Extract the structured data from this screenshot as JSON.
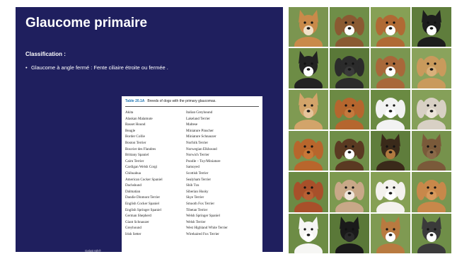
{
  "slide": {
    "title": "Glaucome primaire",
    "classification_label": "Classification :",
    "bullet": "Glaucome à angle fermé : Fente ciliaire étroite ou fermée .",
    "footer": "Gelatt 6th®"
  },
  "table": {
    "number": "Table 20.1A",
    "caption": "Breeds of dogs with the primary glaucomas.",
    "left_column": [
      "Akita",
      "Alaskan Malamute",
      "Basset Hound",
      "Beagle",
      "Border Collie",
      "Boston Terrier",
      "Bouvier des Flandres",
      "Brittany Spaniel",
      "Cairn Terrier",
      "Cardigan Welsh Corgi",
      "Chihuahua",
      "American Cocker Spaniel",
      "Dachshund",
      "Dalmatian",
      "Dandie Dinmont Terrier",
      "English Cocker Spaniel",
      "English Springer Spaniel",
      "German Shepherd",
      "Giant Schnauzer",
      "Greyhound",
      "Irish Setter"
    ],
    "right_column": [
      "Italian Greyhound",
      "Lakeland Terrier",
      "Maltese",
      "Miniature Pinscher",
      "Miniature Schnauzer",
      "Norfolk Terrier",
      "Norwegian Elkhound",
      "Norwich Terrier",
      "Poodle – Toy/Miniature",
      "Samoyed",
      "Scottish Terrier",
      "Sealyham Terrier",
      "Shih Tzu",
      "Siberian Husky",
      "Skye Terrier",
      "Smooth Fox Terrier",
      "Tibetan Terrier",
      "Welsh Springer Spaniel",
      "Welsh Terrier",
      "West Highland White Terrier",
      "Wirehaired Fox Terrier"
    ]
  },
  "colors": {
    "panel_bg": "#1f1f5e",
    "table_number": "#1f76b4"
  },
  "dog_photos": [
    {
      "fur": "#c98a4a",
      "face": "#f1e0c8",
      "ear": "up",
      "bg": "#7b9550"
    },
    {
      "fur": "#8a5a32",
      "face": "#ffffff",
      "ear": "down",
      "bg": "#6f8e48"
    },
    {
      "fur": "#b06a34",
      "face": "#ffffff",
      "ear": "down",
      "bg": "#86a055"
    },
    {
      "fur": "#1d1d1d",
      "face": "#ffffff",
      "ear": "up",
      "bg": "#5f7d3c"
    },
    {
      "fur": "#222222",
      "face": "#ffffff",
      "ear": "up",
      "bg": "#6d8c45"
    },
    {
      "fur": "#2b2b2b",
      "face": "#3a3a3a",
      "ear": "down",
      "bg": "#5a7838"
    },
    {
      "fur": "#a8683a",
      "face": "#ffffff",
      "ear": "down",
      "bg": "#7a9650"
    },
    {
      "fur": "#c99a5c",
      "face": "#d9b07a",
      "ear": "down",
      "bg": "#8aa35c"
    },
    {
      "fur": "#d2a46a",
      "face": "#e6c49a",
      "ear": "up",
      "bg": "#7f9a52"
    },
    {
      "fur": "#b5662e",
      "face": "#c47a3e",
      "ear": "down",
      "bg": "#6c8a44"
    },
    {
      "fur": "#f2f2f2",
      "face": "#ffffff",
      "ear": "down",
      "bg": "#6a8a42"
    },
    {
      "fur": "#d8d0c4",
      "face": "#ebe4d8",
      "ear": "down",
      "bg": "#85a059"
    },
    {
      "fur": "#b8662c",
      "face": "#c87838",
      "ear": "down",
      "bg": "#7a9650"
    },
    {
      "fur": "#5a3a22",
      "face": "#ffffff",
      "ear": "down",
      "bg": "#6f8e48"
    },
    {
      "fur": "#3a2a1a",
      "face": "#b07a40",
      "ear": "up",
      "bg": "#5f7d3c"
    },
    {
      "fur": "#7a5a3a",
      "face": "#8a6a48",
      "ear": "up",
      "bg": "#76924c"
    },
    {
      "fur": "#a8502a",
      "face": "#b86034",
      "ear": "down",
      "bg": "#6c8a44"
    },
    {
      "fur": "#c8a888",
      "face": "#f0e6dc",
      "ear": "down",
      "bg": "#7d9950"
    },
    {
      "fur": "#f4f2ee",
      "face": "#ffffff",
      "ear": "down",
      "bg": "#86a055"
    },
    {
      "fur": "#c8884a",
      "face": "#d89a5c",
      "ear": "down",
      "bg": "#7a9650"
    },
    {
      "fur": "#f6f6f4",
      "face": "#ffffff",
      "ear": "up",
      "bg": "#6d8c45"
    },
    {
      "fur": "#1a1a1a",
      "face": "#2a2a2a",
      "ear": "up",
      "bg": "#5a7838"
    },
    {
      "fur": "#b87a40",
      "face": "#ffffff",
      "ear": "up",
      "bg": "#7f9a52"
    },
    {
      "fur": "#3a3a3a",
      "face": "#ffffff",
      "ear": "up",
      "bg": "#6f8e48"
    }
  ]
}
